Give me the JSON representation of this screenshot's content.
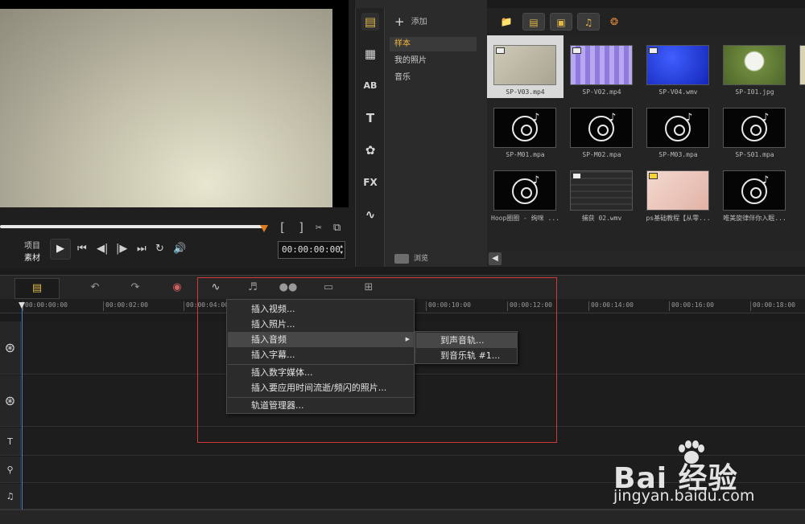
{
  "preview": {
    "mode_project": "项目",
    "mode_clip": "素材",
    "trim_in": "[",
    "trim_out": "]",
    "timecode": "00:00:00:00"
  },
  "library": {
    "add_label": "添加",
    "folders": [
      "样本",
      "我的照片",
      "音乐"
    ],
    "browse_label": "浏览",
    "media": [
      {
        "caption": "SP-V03.mp4",
        "kind": "video-beige"
      },
      {
        "caption": "SP-V02.mp4",
        "kind": "video-mosaic"
      },
      {
        "caption": "SP-V04.wmv",
        "kind": "video-blue"
      },
      {
        "caption": "SP-I01.jpg",
        "kind": "image-dandelion"
      },
      {
        "caption": "SP-M01.mpa",
        "kind": "audio"
      },
      {
        "caption": "SP-M02.mpa",
        "kind": "audio"
      },
      {
        "caption": "SP-M03.mpa",
        "kind": "audio"
      },
      {
        "caption": "SP-S01.mpa",
        "kind": "audio"
      },
      {
        "caption": "Hoop圈圈 - 绚咪 ...",
        "kind": "audio"
      },
      {
        "caption": "捕获 02.wmv",
        "kind": "video-screen"
      },
      {
        "caption": "ps基础教程【从零...",
        "kind": "video-pink"
      },
      {
        "caption": "唯美旋律伴你入眠...",
        "kind": "audio"
      }
    ]
  },
  "timeline": {
    "ruler_ticks": [
      "00:00:00:00",
      "00:00:02:00",
      "00:00:04:00",
      "00:00:10:00",
      "00:00:12:00",
      "00:00:14:00",
      "00:00:16:00",
      "00:00:18:00"
    ]
  },
  "context_menu": {
    "items": [
      "插入视频...",
      "插入照片...",
      "插入音频",
      "插入字幕...",
      "插入数字媒体...",
      "插入要应用时间流逝/频闪的照片...",
      "轨道管理器..."
    ],
    "submenu": [
      "到声音轨...",
      "到音乐轨 #1..."
    ]
  },
  "watermark": {
    "brand": "Bai 经验",
    "url": "jingyan.baidu.com"
  },
  "colors": {
    "accent": "#e0b84a",
    "highlight_box": "#d23a3a",
    "playhead": "#4a7fd0"
  }
}
